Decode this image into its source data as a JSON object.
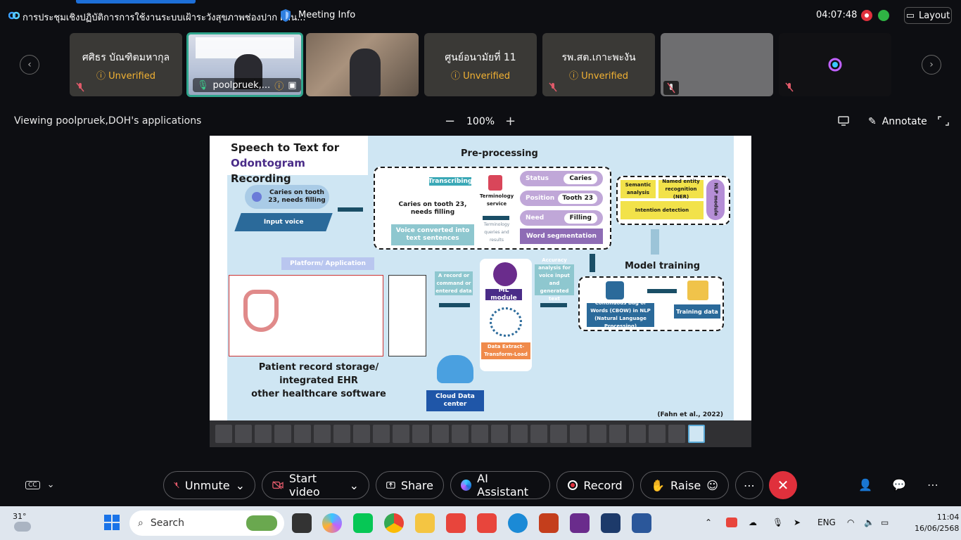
{
  "titlebar": {
    "meeting_title": "การประชุมเชิงปฏิบัติการการใช้งานระบบเฝ้าระวังสุขภาพช่องปาก ผ่าน...",
    "meeting_info": "Meeting Info",
    "clock": "04:07:48",
    "layout_label": "Layout"
  },
  "participants": [
    {
      "name": "ศศิธร บัณฑิตมหากุล",
      "status": "Unverified"
    },
    {
      "name": "poolpruek,..."
    },
    {
      "name": ""
    },
    {
      "name": "ศูนย์อนามัยที่ 11",
      "status": "Unverified"
    },
    {
      "name": "รพ.สต.เกาะพะงัน",
      "status": "Unverified"
    },
    {
      "name": ""
    },
    {
      "name": ""
    }
  ],
  "share_bar": {
    "viewing_text": "Viewing poolpruek,DOH's applications",
    "zoom_minus": "−",
    "zoom_level": "100%",
    "zoom_plus": "+",
    "annotate_label": "Annotate"
  },
  "slide": {
    "title_line1": "Speech to Text for",
    "title_hl": "Odontogram",
    "title_rest": " Recording",
    "preprocessing": "Pre-processing",
    "caries_bubble": "Caries on tooth 23, needs filling",
    "input_voice": "Input voice",
    "transcribing": "Transcribing",
    "caries_text": "Caries on tooth 23, needs filling",
    "voice_converted": "Voice converted into text sentences",
    "terminology": "Terminology service",
    "terminology_sub": "Terminology queries and results",
    "status_label": "Status",
    "status_value": "Caries",
    "position_label": "Position",
    "position_value": "Tooth 23",
    "need_label": "Need",
    "need_value": "Filling",
    "word_segmentation": "Word segmentation",
    "semantic": "Semantic analysis",
    "ner": "Named entity recognition (NER)",
    "intention": "Intention detection",
    "nlp_module": "NLP module",
    "model_training": "Model training",
    "platform": "Platform/ Application",
    "record_box": "A record or command or entered data",
    "ml_module": "ML module",
    "etl": "Data Extract-Transform-Load",
    "accuracy": "Accuracy analysis for voice input and generated text",
    "cbow": "Continuous Bag of Words (CBOW) in NLP (Natural Language Processing)",
    "training_data": "Training data",
    "ehr_caption_1": "Patient record storage/ integrated EHR",
    "ehr_caption_2": "other healthcare software",
    "cloud": "Cloud Data center",
    "citation": "(Fahn et al., 2022)"
  },
  "controls": {
    "unmute": "Unmute",
    "start_video": "Start video",
    "share": "Share",
    "ai_assistant": "AI Assistant",
    "record": "Record",
    "raise": "Raise"
  },
  "taskbar": {
    "temperature": "31°",
    "search_placeholder": "Search",
    "lang": "ENG",
    "time": "11:04",
    "date": "16/06/2568"
  },
  "colors": {
    "accent": "#1d6fd8",
    "end_call": "#e0303c",
    "unverified": "#f2b233",
    "active_tile_border": "#2fa58c"
  }
}
